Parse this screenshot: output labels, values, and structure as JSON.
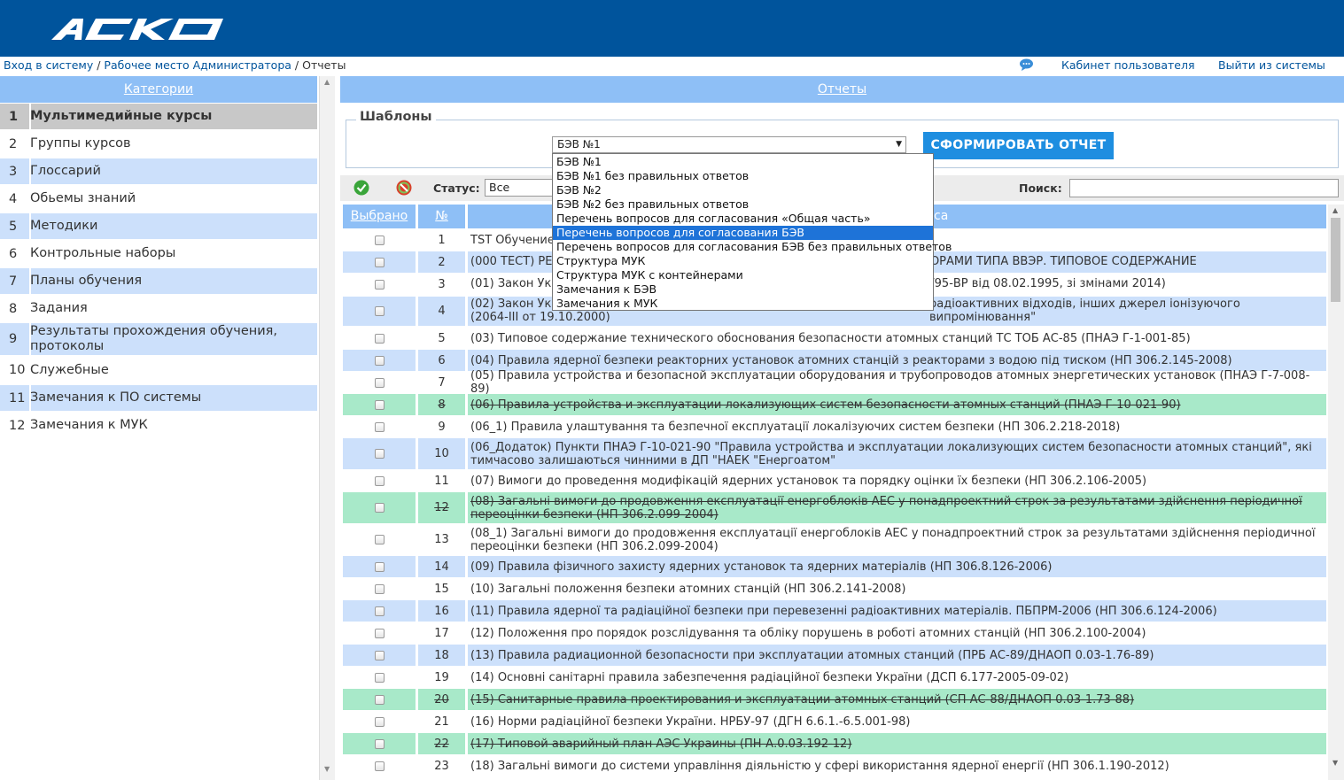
{
  "header": {
    "logo_text": "ACKO"
  },
  "breadcrumb": {
    "login": "Вход в систему",
    "sep1": " / ",
    "admin": "Рабочее место Администратора",
    "sep2": " / ",
    "current": "Отчеты"
  },
  "topnav": {
    "cabinet": "Кабинет пользователя",
    "logout": "Выйти из системы"
  },
  "sidebar": {
    "header": "Категории",
    "items": [
      {
        "num": "1",
        "label": "Мультимедийные курсы"
      },
      {
        "num": "2",
        "label": "Группы курсов"
      },
      {
        "num": "3",
        "label": "Глоссарий"
      },
      {
        "num": "4",
        "label": "Обьемы знаний"
      },
      {
        "num": "5",
        "label": "Методики"
      },
      {
        "num": "6",
        "label": "Контрольные наборы"
      },
      {
        "num": "7",
        "label": "Планы обучения"
      },
      {
        "num": "8",
        "label": "Задания"
      },
      {
        "num": "9",
        "label": "Результаты прохождения обучения, протоколы"
      },
      {
        "num": "10",
        "label": "Служебные"
      },
      {
        "num": "11",
        "label": "Замечания к ПО системы"
      },
      {
        "num": "12",
        "label": "Замечания к МУК"
      }
    ]
  },
  "main": {
    "header": "Отчеты",
    "templates_legend": "Шаблоны",
    "template_select_value": "БЭВ №1",
    "form_button": "СФОРМИРОВАТЬ ОТЧЕТ",
    "dropdown_options": [
      "БЭВ №1",
      "БЭВ №1 без правильных ответов",
      "БЭВ №2",
      "БЭВ №2 без правильных ответов",
      "Перечень вопросов для согласования «Общая часть»",
      "Перечень вопросов для согласования БЭВ",
      "Перечень вопросов для согласования БЭВ без правильных ответов",
      "Структура МУК",
      "Структура МУК с контейнерами",
      "Замечания к БЭВ",
      "Замечания к МУК"
    ],
    "highlighted_option": "Перечень вопросов для согласования БЭВ",
    "status_label": "Статус:",
    "status_value": "Все",
    "search_label": "Поиск:",
    "search_value": "",
    "table": {
      "col_selected": "Выбрано",
      "col_num": "№",
      "col_title_visible_tail": "са",
      "rows": [
        {
          "num": "1",
          "title": "TST Обучение"
        },
        {
          "num": "2",
          "title_left": "(000 ТЕСТ) РЕГ",
          "title_right": "ТОРАМИ ТИПА ВВЭР. ТИПОВОЕ СОДЕРЖАНИЕ"
        },
        {
          "num": "3",
          "title_left": "(01) Закон Укр",
          "title_right": "9/95-ВР від 08.02.1995, зі змінами 2014)"
        },
        {
          "num": "4",
          "title_left": "(02) Закон Укр",
          "title_right": "радіоактивних відходів, інших джерел іонізуючого випромінювання\"",
          "title_line2": "(2064-III от 19.10.2000)"
        },
        {
          "num": "5",
          "title": "(03) Типовое содержание технического обоснования безопасности атомных станций ТС ТОБ АС-85 (ПНАЭ Г-1-001-85)"
        },
        {
          "num": "6",
          "title": "(04) Правила ядерної безпеки реакторних установок атомних станцій з реакторами з водою під тиском (НП 306.2.145-2008)"
        },
        {
          "num": "7",
          "title": "(05) Правила устройства и безопасной эксплуатации оборудования и трубопроводов атомных энергетических установок (ПНАЭ Г-7-008-89)"
        },
        {
          "num": "8",
          "title": "(06) Правила устройства и эксплуатации локализующих систем безопасности атомных станций (ПНАЭ Г-10-021-90)"
        },
        {
          "num": "9",
          "title": "(06_1) Правила улаштування та безпечної експлуатації локалізуючих систем безпеки (НП 306.2.218-2018)"
        },
        {
          "num": "10",
          "title": "(06_Додаток) Пункти ПНАЭ Г-10-021-90 \"Правила устройства и эксплуатации локализующих систем безопасности атомных станций\", які тимчасово залишаються чинними в ДП \"НАЕК \"Енергоатом\""
        },
        {
          "num": "11",
          "title": "(07) Вимоги до проведення модифікацій ядерних установок та порядку оцінки їх безпеки (НП 306.2.106-2005)"
        },
        {
          "num": "12",
          "title": "(08) Загальні вимоги до продовження експлуатації енергоблоків АЕС у понадпроектний строк за результатами здійснення періодичної переоцінки безпеки (НП 306.2.099-2004)"
        },
        {
          "num": "13",
          "title": "(08_1) Загальні вимоги до продовження експлуатації енергоблоків АЕС у понадпроектний строк за результатами здійснення періодичної переоцінки безпеки (НП 306.2.099-2004)"
        },
        {
          "num": "14",
          "title": "(09) Правила фізичного захисту ядерних установок та ядерних матеріалів (НП 306.8.126-2006)"
        },
        {
          "num": "15",
          "title": "(10) Загальні положення безпеки атомних станцій (НП 306.2.141-2008)"
        },
        {
          "num": "16",
          "title": "(11) Правила ядерної та радіаційної безпеки при перевезенні радіоактивних матеріалів. ПБПРМ-2006 (НП 306.6.124-2006)"
        },
        {
          "num": "17",
          "title": "(12) Положення про порядок розслідування та обліку порушень в роботі атомних станцій (НП 306.2.100-2004)"
        },
        {
          "num": "18",
          "title": "(13) Правила радиационной безопасности при эксплуатации атомных станций (ПРБ АС-89/ДНАОП 0.03-1.76-89)"
        },
        {
          "num": "19",
          "title": "(14) Основні санітарні правила забезпечення радіаційної безпеки України (ДСП 6.177-2005-09-02)"
        },
        {
          "num": "20",
          "title": "(15) Санитарные правила проектирования и эксплуатации атомных станций (СП АС-88/ДНАОП 0.03-1.73-88)"
        },
        {
          "num": "21",
          "title": "(16) Норми радіаційної безпеки України. НРБУ-97 (ДГН 6.6.1.-6.5.001-98)"
        },
        {
          "num": "22",
          "title": "(17) Типовой аварийный план АЭС Украины (ПН-А.0.03.192-12)"
        },
        {
          "num": "23",
          "title": "(18) Загальні вимоги до системи управління діяльністю у сфері використання ядерної енергії (НП 306.1.190-2012)"
        }
      ]
    }
  },
  "colors": {
    "header_bg": "#00549c",
    "band_blue": "#8ebff6",
    "row_blue": "#cce0fb",
    "row_green": "#a8e9c9",
    "button": "#1e8ee0",
    "dropdown_highlight": "#1e73d8"
  }
}
